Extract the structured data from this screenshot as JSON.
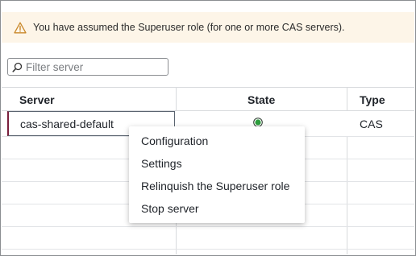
{
  "banner": {
    "message": "You have assumed the Superuser role (for one or more CAS servers).",
    "icon": "warning-icon",
    "color": "#fdf5e8"
  },
  "filter": {
    "placeholder": "Filter server",
    "value": "",
    "icon": "search-icon"
  },
  "table": {
    "columns": [
      "Server",
      "State",
      "Type"
    ],
    "rows": [
      {
        "server": "cas-shared-default",
        "state_icon": "status-running-icon",
        "state_color": "#2e9e3e",
        "type": "CAS"
      }
    ]
  },
  "context_menu": {
    "items": [
      "Configuration",
      "Settings",
      "Relinquish the Superuser role",
      "Stop server"
    ]
  }
}
